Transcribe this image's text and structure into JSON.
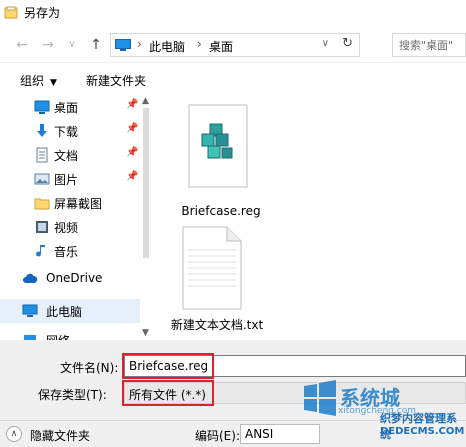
{
  "window": {
    "title": "另存为"
  },
  "address": {
    "crumbs": [
      "此电脑",
      "桌面"
    ],
    "search_placeholder": "搜索\"桌面\""
  },
  "toolbar": {
    "organize_label": "组织",
    "new_folder_label": "新建文件夹"
  },
  "sidebar": {
    "items": [
      {
        "label": "桌面",
        "icon": "desktop-icon",
        "pinned": true
      },
      {
        "label": "下载",
        "icon": "download-icon",
        "pinned": true
      },
      {
        "label": "文档",
        "icon": "document-icon",
        "pinned": true
      },
      {
        "label": "图片",
        "icon": "picture-icon",
        "pinned": true
      },
      {
        "label": "屏幕截图",
        "icon": "folder-icon",
        "pinned": false
      },
      {
        "label": "视频",
        "icon": "video-icon",
        "pinned": false
      },
      {
        "label": "音乐",
        "icon": "music-icon",
        "pinned": false
      },
      {
        "label": "OneDrive",
        "icon": "cloud-icon",
        "pinned": false
      },
      {
        "label": "此电脑",
        "icon": "computer-icon",
        "pinned": false,
        "selected": true
      },
      {
        "label": "网络",
        "icon": "network-icon",
        "pinned": false
      }
    ]
  },
  "files": [
    {
      "name": "Briefcase.reg",
      "icon": "registry-file-icon"
    },
    {
      "name": "新建文本文档.txt",
      "icon": "text-file-icon"
    }
  ],
  "form": {
    "filename_label": "文件名(N):",
    "filename_value": "Briefcase.reg",
    "filetype_label": "保存类型(T):",
    "filetype_value": "所有文件  (*.*)",
    "hide_folders_label": "隐藏文件夹",
    "encoding_label": "编码(E):",
    "encoding_value": "ANSI"
  },
  "watermark": {
    "brand": "系统城",
    "brand_sub": "xitongcheng.com",
    "site_cn": "织梦内容管理系统",
    "site_en": "DEDECMS.COM"
  },
  "colors": {
    "accent": "#1979ca",
    "highlight_box": "#d9232e",
    "selected_bg": "#e5f0fb"
  }
}
